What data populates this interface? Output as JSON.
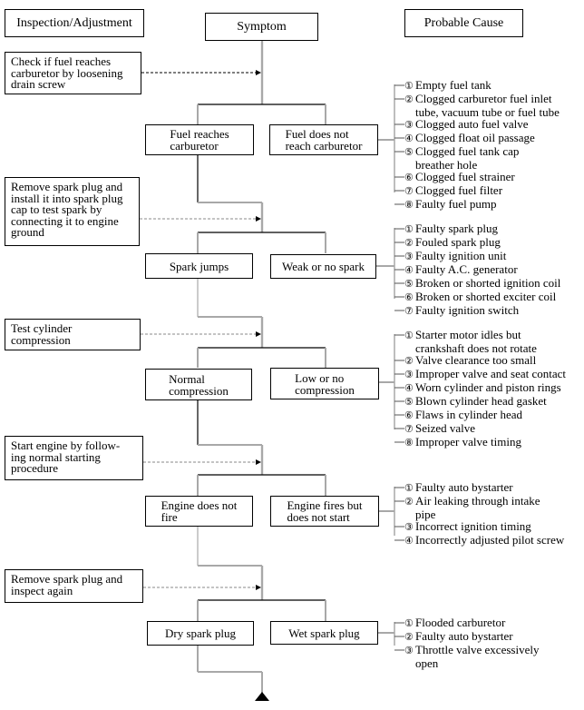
{
  "headers": {
    "inspection": "Inspection/Adjustment",
    "symptom": "Symptom",
    "probable_cause": "Probable Cause"
  },
  "steps": [
    {
      "inspection": "Check if fuel reaches\ncarburetor by loosening\ndrain screw",
      "ok": "Fuel reaches\ncarburetor",
      "fault": "Fuel does not\nreach carburetor",
      "causes": [
        {
          "num": "①",
          "lines": [
            "Empty fuel tank"
          ]
        },
        {
          "num": "②",
          "lines": [
            "Clogged carburetor fuel inlet",
            "tube, vacuum tube or fuel tube"
          ]
        },
        {
          "num": "③",
          "lines": [
            "Clogged auto fuel valve"
          ]
        },
        {
          "num": "④",
          "lines": [
            "Clogged float oil passage"
          ]
        },
        {
          "num": "⑤",
          "lines": [
            "Clogged fuel tank cap",
            "breather hole"
          ]
        },
        {
          "num": "⑥",
          "lines": [
            "Clogged fuel strainer"
          ]
        },
        {
          "num": "⑦",
          "lines": [
            "Clogged fuel filter"
          ]
        },
        {
          "num": "⑧",
          "lines": [
            "Faulty fuel pump"
          ]
        }
      ]
    },
    {
      "inspection": "Remove spark plug and\ninstall it into spark plug\ncap to test spark by\nconnecting it to engine\nground",
      "ok": "Spark jumps",
      "fault": "Weak or no spark",
      "causes": [
        {
          "num": "①",
          "lines": [
            "Faulty spark plug"
          ]
        },
        {
          "num": "②",
          "lines": [
            "Fouled spark plug"
          ]
        },
        {
          "num": "③",
          "lines": [
            "Faulty ignition unit"
          ]
        },
        {
          "num": "④",
          "lines": [
            "Faulty A.C. generator"
          ]
        },
        {
          "num": "⑤",
          "lines": [
            "Broken or shorted ignition coil"
          ]
        },
        {
          "num": "⑥",
          "lines": [
            "Broken or shorted exciter coil"
          ]
        },
        {
          "num": "⑦",
          "lines": [
            "Faulty ignition switch"
          ]
        }
      ]
    },
    {
      "inspection": "Test cylinder\ncompression",
      "ok": "Normal\ncompression",
      "fault": "Low or no\ncompression",
      "causes": [
        {
          "num": "①",
          "lines": [
            "Starter motor idles but",
            "crankshaft does not rotate"
          ]
        },
        {
          "num": "②",
          "lines": [
            "Valve clearance too small"
          ]
        },
        {
          "num": "③",
          "lines": [
            "Improper valve and seat contact"
          ]
        },
        {
          "num": "④",
          "lines": [
            "Worn cylinder and piston rings"
          ]
        },
        {
          "num": "⑤",
          "lines": [
            "Blown cylinder head gasket"
          ]
        },
        {
          "num": "⑥",
          "lines": [
            "Flaws in cylinder head"
          ]
        },
        {
          "num": "⑦",
          "lines": [
            "Seized valve"
          ]
        },
        {
          "num": "⑧",
          "lines": [
            "Improper valve timing"
          ]
        }
      ]
    },
    {
      "inspection": "Start engine by follow-\ning normal starting\nprocedure",
      "ok": "Engine does not\nfire",
      "fault": "Engine fires but\ndoes not start",
      "causes": [
        {
          "num": "①",
          "lines": [
            "Faulty auto bystarter"
          ]
        },
        {
          "num": "②",
          "lines": [
            "Air leaking through intake",
            "pipe"
          ]
        },
        {
          "num": "③",
          "lines": [
            "Incorrect ignition timing"
          ]
        },
        {
          "num": "④",
          "lines": [
            "Incorrectly adjusted pilot screw"
          ]
        }
      ]
    },
    {
      "inspection": "Remove spark plug and\ninspect again",
      "ok": "Dry spark plug",
      "fault": "Wet spark plug",
      "causes": [
        {
          "num": "①",
          "lines": [
            "Flooded carburetor"
          ]
        },
        {
          "num": "②",
          "lines": [
            "Faulty auto bystarter"
          ]
        },
        {
          "num": "③",
          "lines": [
            "Throttle valve excessively",
            "open"
          ]
        }
      ]
    }
  ],
  "colors": {
    "line_gray": "#a8a8a8",
    "line_black": "#000000"
  }
}
